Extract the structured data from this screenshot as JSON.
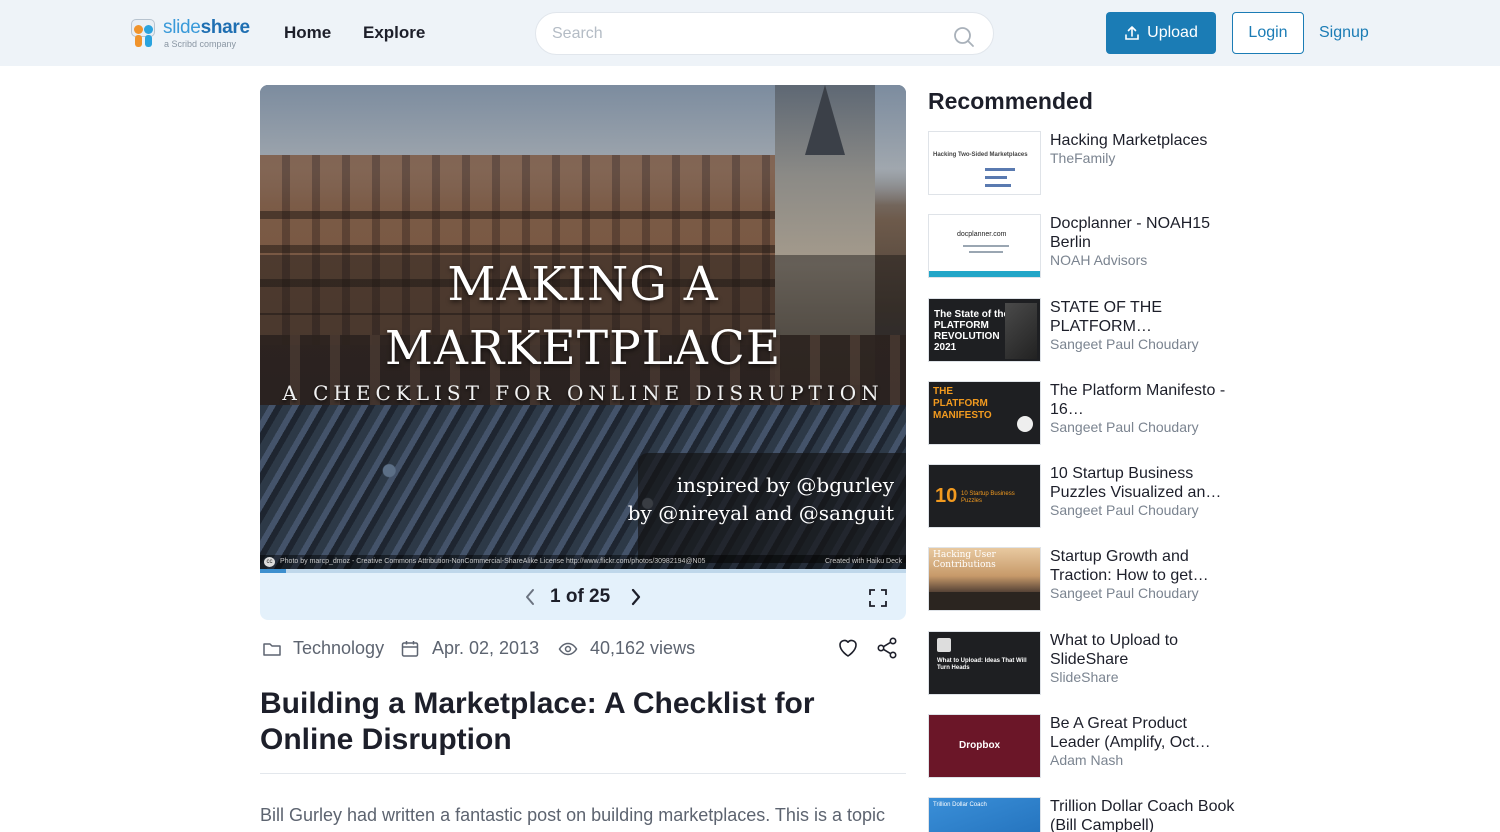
{
  "header": {
    "logo_name_light": "slide",
    "logo_name_bold": "share",
    "logo_sub": "a Scribd company",
    "nav": [
      "Home",
      "Explore"
    ],
    "search_placeholder": "Search",
    "upload_label": "Upload",
    "login_label": "Login",
    "signup_label": "Signup"
  },
  "slide": {
    "title_line1": "MAKING A",
    "title_line2": "MARKETPLACE",
    "subtitle": "A CHECKLIST FOR ONLINE DISRUPTION",
    "credit_line1": "inspired by @bgurley",
    "credit_line2": "by @nireyal and @sanguit",
    "license": "Photo by marcp_dmoz - Creative Commons Attribution-NonCommercial-ShareAlike License  http://www.flickr.com/photos/30982194@N05",
    "made_with": "Created with Haiku Deck",
    "current_page": 1,
    "total_pages": 25,
    "pager_text": "1 of 25",
    "progress_fraction": 0.04
  },
  "meta": {
    "category": "Technology",
    "date": "Apr. 02, 2013",
    "views": "40,162 views"
  },
  "document": {
    "title": "Building a Marketplace: A Checklist for Online Disruption",
    "description": "Bill Gurley had written a fantastic post on building marketplaces. This is a topic that I have myself been very passionate about. My friend Nir Eyal and I"
  },
  "recommended": {
    "heading": "Recommended",
    "items": [
      {
        "title": "Hacking Marketplaces",
        "author": "TheFamily",
        "thumb_text": "Hacking Two-Sided Marketplaces"
      },
      {
        "title": "Docplanner - NOAH15 Berlin",
        "author": "NOAH Advisors",
        "thumb_text": "docplanner.com"
      },
      {
        "title": "STATE OF THE PLATFORM…",
        "author": "Sangeet Paul Choudary",
        "thumb_text": "The State of the PLATFORM REVOLUTION 2021"
      },
      {
        "title": "The Platform Manifesto - 16…",
        "author": "Sangeet Paul Choudary",
        "thumb_text": "THE PLATFORM MANIFESTO"
      },
      {
        "title": "10 Startup Business Puzzles Visualized an…",
        "author": "Sangeet Paul Choudary",
        "thumb_text": "10 Startup Business Puzzles"
      },
      {
        "title": "Startup Growth and Traction: How to get…",
        "author": "Sangeet Paul Choudary",
        "thumb_text": "Hacking User Contributions"
      },
      {
        "title": "What to Upload to SlideShare",
        "author": "SlideShare",
        "thumb_text": "What to Upload: Ideas That Will Turn Heads"
      },
      {
        "title": "Be A Great Product Leader (Amplify, Oct…",
        "author": "Adam Nash",
        "thumb_text": "Dropbox"
      },
      {
        "title": "Trillion Dollar Coach Book (Bill Campbell)",
        "author": "",
        "thumb_text": "Trillion Dollar Coach"
      }
    ]
  }
}
